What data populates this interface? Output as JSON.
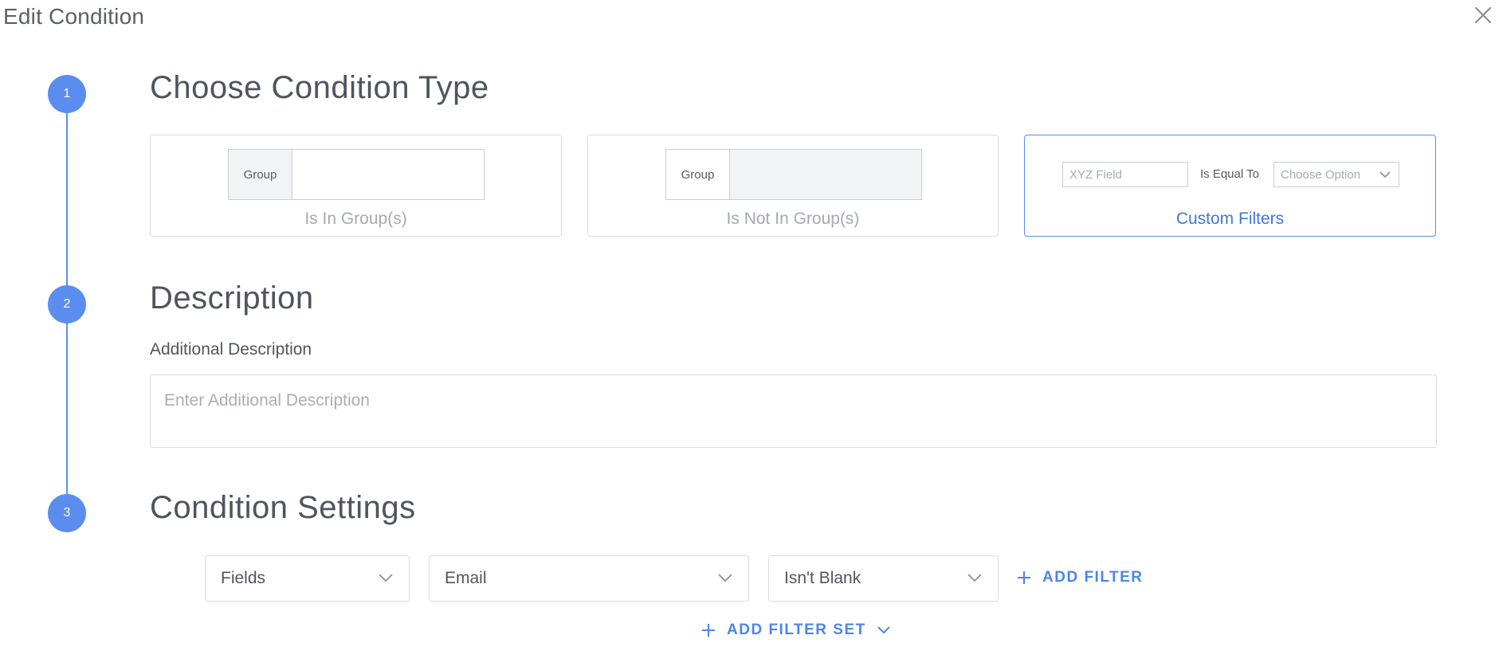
{
  "header": {
    "title": "Edit Condition"
  },
  "steps": {
    "step1": {
      "number": "1",
      "title": "Choose Condition Type"
    },
    "step2": {
      "number": "2",
      "title": "Description"
    },
    "step3": {
      "number": "3",
      "title": "Condition Settings"
    }
  },
  "condition_types": {
    "in_group": {
      "group_label": "Group",
      "label": "Is In Group(s)"
    },
    "not_in_group": {
      "group_label": "Group",
      "label": "Is Not In Group(s)"
    },
    "custom": {
      "field_placeholder": "XYZ Field",
      "operator": "Is Equal To",
      "option_placeholder": "Choose Option",
      "label": "Custom Filters",
      "selected": true
    }
  },
  "description": {
    "label": "Additional Description",
    "placeholder": "Enter Additional Description"
  },
  "settings": {
    "field_type": "Fields",
    "field": "Email",
    "operator": "Isn't Blank",
    "add_filter_label": "ADD FILTER",
    "add_filter_set_label": "ADD FILTER SET"
  },
  "colors": {
    "accent": "#5b8def",
    "link": "#4a86e8",
    "border": "#d9dce1",
    "placeholder": "#a4a9b3"
  },
  "icons": [
    "close-icon",
    "chevron-down-icon",
    "plus-icon"
  ]
}
